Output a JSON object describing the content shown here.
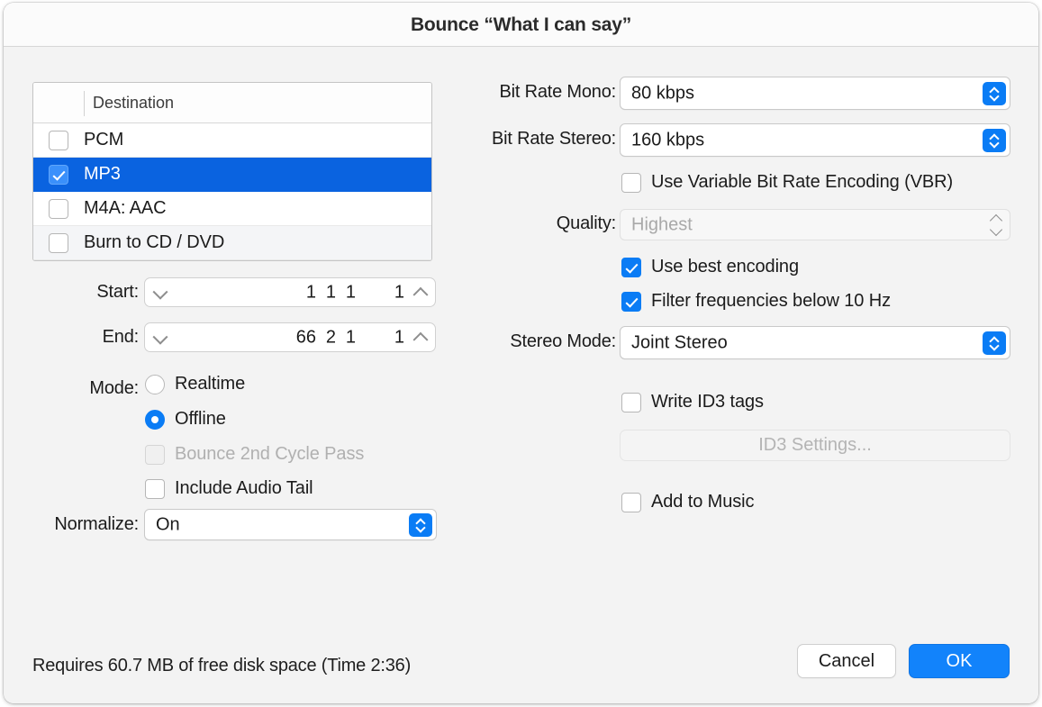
{
  "window": {
    "title": "Bounce “What I can say”"
  },
  "destination": {
    "column_header": "Destination",
    "items": [
      {
        "label": "PCM",
        "checked": false,
        "selected": false
      },
      {
        "label": "MP3",
        "checked": true,
        "selected": true
      },
      {
        "label": "M4A: AAC",
        "checked": false,
        "selected": false
      },
      {
        "label": "Burn to CD / DVD",
        "checked": false,
        "selected": false
      }
    ]
  },
  "range": {
    "start_label": "Start:",
    "start": {
      "bar": "1",
      "beat": "1",
      "division": "1",
      "ticks": "1"
    },
    "end_label": "End:",
    "end": {
      "bar": "66",
      "beat": "2",
      "division": "1",
      "ticks": "1"
    }
  },
  "mode": {
    "label": "Mode:",
    "realtime": "Realtime",
    "offline": "Offline",
    "selected": "Offline",
    "second_cycle_pass": "Bounce 2nd Cycle Pass",
    "second_cycle_pass_checked": false,
    "second_cycle_pass_disabled": true,
    "include_audio_tail": "Include Audio Tail",
    "include_audio_tail_checked": false
  },
  "normalize": {
    "label": "Normalize:",
    "value": "On"
  },
  "encoding": {
    "bit_rate_mono_label": "Bit Rate Mono:",
    "bit_rate_mono": "80 kbps",
    "bit_rate_stereo_label": "Bit Rate Stereo:",
    "bit_rate_stereo": "160 kbps",
    "vbr_label": "Use Variable Bit Rate Encoding (VBR)",
    "vbr_checked": false,
    "quality_label": "Quality:",
    "quality_value": "Highest",
    "quality_disabled": true,
    "best_encoding_label": "Use best encoding",
    "best_encoding_checked": true,
    "filter_label": "Filter frequencies below 10 Hz",
    "filter_checked": true,
    "stereo_mode_label": "Stereo Mode:",
    "stereo_mode": "Joint Stereo"
  },
  "tags": {
    "write_id3_label": "Write ID3 tags",
    "write_id3_checked": false,
    "id3_settings_button": "ID3 Settings...",
    "id3_settings_disabled": true,
    "add_to_music_label": "Add to Music",
    "add_to_music_checked": false
  },
  "footer": {
    "status": "Requires 60.7 MB of free disk space  (Time 2:36)",
    "cancel_label": "Cancel",
    "ok_label": "OK"
  },
  "colors": {
    "accent": "#0a7cf5",
    "selection": "#0a63e0",
    "default_button": "#1283fb",
    "window_bg": "#f3f3f3"
  }
}
